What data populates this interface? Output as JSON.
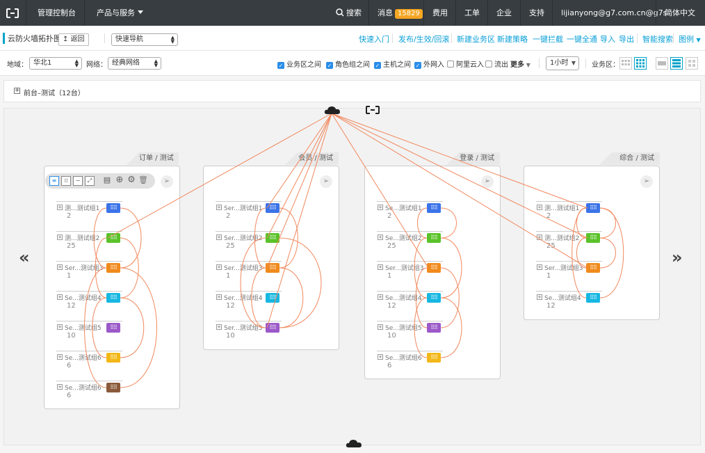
{
  "topbar": {
    "console": "管理控制台",
    "products": "产品与服务",
    "search": "搜索",
    "messages": "消息",
    "message_count": "15829",
    "billing": "费用",
    "tickets": "工单",
    "enterprise": "企业",
    "support": "支持",
    "user": "lijianyong@g7.com.cn@g7s",
    "language": "简体中文"
  },
  "toolbar": {
    "title": "云防火墙拓扑图",
    "back": "返回",
    "quick_nav": "快速导航",
    "links": [
      "快速入门",
      "发布/生效/回滚",
      "新建业务区",
      "新建策略",
      "一键拦截",
      "一键全通",
      "导入",
      "导出",
      "智能搜索",
      "图例"
    ]
  },
  "filters": {
    "region_label": "地域：",
    "region_value": "华北1",
    "network_label": "网络：",
    "network_value": "经典网络",
    "checks": [
      {
        "label": "业务区之间",
        "checked": true
      },
      {
        "label": "角色组之间",
        "checked": true
      },
      {
        "label": "主机之间",
        "checked": true
      },
      {
        "label": "外网入",
        "checked": true
      },
      {
        "label": "阿里云入",
        "checked": false
      },
      {
        "label": "流出",
        "checked": false
      }
    ],
    "more": "更多",
    "time_value": "1小时",
    "zone_label": "业务区："
  },
  "group": {
    "label": "前台–测试（12台）"
  },
  "zones": [
    {
      "tab": "订单 / 测试",
      "nodes": [
        {
          "name": "测...测试组1",
          "count": "2",
          "color": "#3b73e8"
        },
        {
          "name": "测...测试组2",
          "count": "25",
          "color": "#5ac22a"
        },
        {
          "name": "Ser...测试组3",
          "count": "1",
          "color": "#f08a1c"
        },
        {
          "name": "Se...测试组4",
          "count": "12",
          "color": "#17b7e2"
        },
        {
          "name": "Se...测试组5",
          "count": "10",
          "color": "#9b59c9"
        },
        {
          "name": "Se...测试组6",
          "count": "6",
          "color": "#f2b718"
        },
        {
          "name": "Se...测试组6",
          "count": "6",
          "color": "#8a5a3a"
        }
      ]
    },
    {
      "tab": "会员 / 测试",
      "nodes": [
        {
          "name": "Ser...测试组1",
          "count": "2",
          "color": "#3b73e8"
        },
        {
          "name": "Ser...测试组2",
          "count": "25",
          "color": "#5ac22a"
        },
        {
          "name": "Ser...测试组3",
          "count": "1",
          "color": "#f08a1c"
        },
        {
          "name": "Ser...测试组4",
          "count": "12",
          "color": "#17b7e2"
        },
        {
          "name": "Ser...测试组5",
          "count": "10",
          "color": "#9b59c9"
        }
      ]
    },
    {
      "tab": "登录 / 测试",
      "nodes": [
        {
          "name": "Se...测试组1",
          "count": "2",
          "color": "#3b73e8"
        },
        {
          "name": "Se...测试组2",
          "count": "25",
          "color": "#5ac22a"
        },
        {
          "name": "Ser...测试组3",
          "count": "1",
          "color": "#f08a1c"
        },
        {
          "name": "Se...测试组4",
          "count": "12",
          "color": "#17b7e2"
        },
        {
          "name": "Se...测试组5",
          "count": "10",
          "color": "#9b59c9"
        },
        {
          "name": "Se...测试组6",
          "count": "6",
          "color": "#f2b718"
        }
      ]
    },
    {
      "tab": "综合 / 测试",
      "nodes": [
        {
          "name": "测...测试组1",
          "count": "2",
          "color": "#3b73e8"
        },
        {
          "name": "测...测试组2",
          "count": "25",
          "color": "#5ac22a"
        },
        {
          "name": "Ser...测试组3",
          "count": "1",
          "color": "#f08a1c"
        },
        {
          "name": "Se...测试组4",
          "count": "12",
          "color": "#17b7e2"
        }
      ]
    }
  ],
  "colors": {
    "accent": "#00a2ca",
    "link": "#0aa0d8",
    "edge": "#f2875c",
    "checkbox": "#2a8de8"
  },
  "icons": {
    "cloud": "cloud-icon",
    "plane": "paper-plane-icon",
    "prev": "double-chevron-left-icon",
    "next": "double-chevron-right-icon"
  }
}
